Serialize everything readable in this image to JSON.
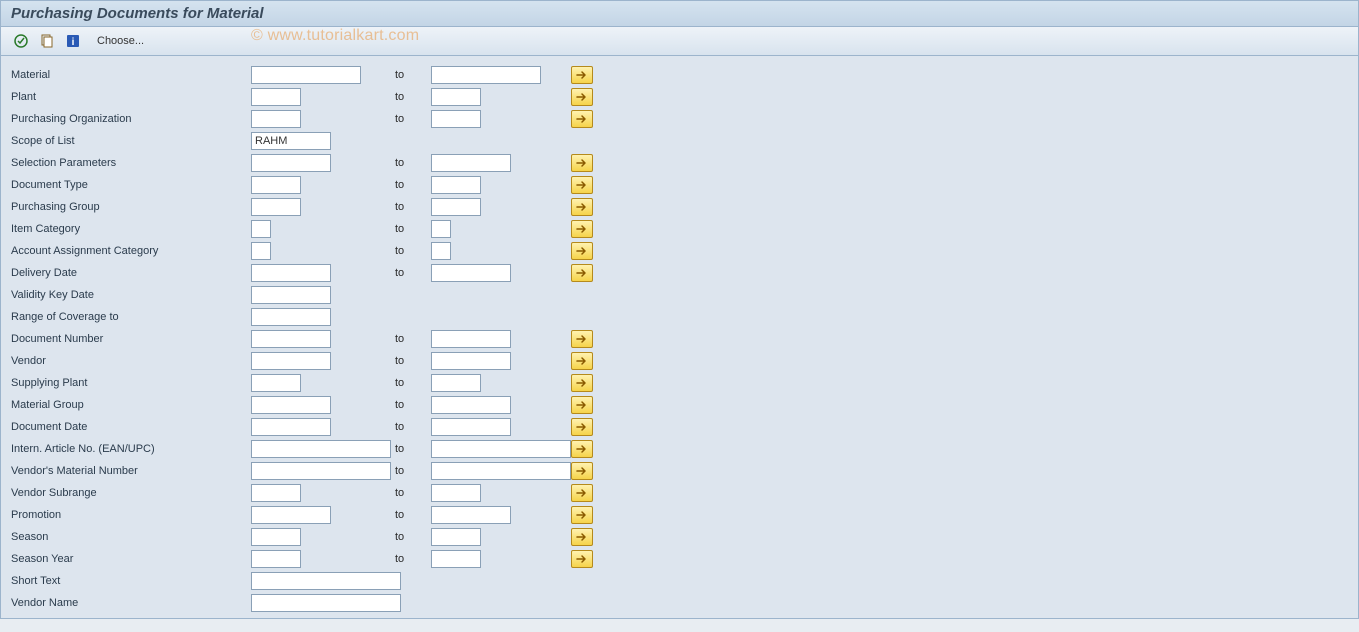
{
  "window_title": "Purchasing Documents for Material",
  "toolbar": {
    "choose_label": "Choose..."
  },
  "watermark": "© www.tutorialkart.com",
  "ui": {
    "to_label": "to"
  },
  "rows": {
    "material": {
      "label": "Material",
      "from": "",
      "to": "",
      "showTo": true,
      "btn": true,
      "fromW": "w110",
      "toW": "w110"
    },
    "plant": {
      "label": "Plant",
      "from": "",
      "to": "",
      "showTo": true,
      "btn": true,
      "fromW": "w50",
      "toW": "w50"
    },
    "purchOrg": {
      "label": "Purchasing Organization",
      "from": "",
      "to": "",
      "showTo": true,
      "btn": true,
      "fromW": "w50",
      "toW": "w50"
    },
    "scopeList": {
      "label": "Scope of List",
      "from": "RAHM",
      "to": "",
      "showTo": false,
      "btn": false,
      "fromW": "w80",
      "toW": ""
    },
    "selParams": {
      "label": "Selection Parameters",
      "from": "",
      "to": "",
      "showTo": true,
      "btn": true,
      "fromW": "w80",
      "toW": "w80"
    },
    "docType": {
      "label": "Document Type",
      "from": "",
      "to": "",
      "showTo": true,
      "btn": true,
      "fromW": "w50",
      "toW": "w50"
    },
    "purchGrp": {
      "label": "Purchasing Group",
      "from": "",
      "to": "",
      "showTo": true,
      "btn": true,
      "fromW": "w50",
      "toW": "w50"
    },
    "itemCat": {
      "label": "Item Category",
      "from": "",
      "to": "",
      "showTo": true,
      "btn": true,
      "fromW": "w20",
      "toW": "w20"
    },
    "acctAssign": {
      "label": "Account Assignment Category",
      "from": "",
      "to": "",
      "showTo": true,
      "btn": true,
      "fromW": "w20",
      "toW": "w20"
    },
    "deliveryDate": {
      "label": "Delivery Date",
      "from": "",
      "to": "",
      "showTo": true,
      "btn": true,
      "fromW": "w80",
      "toW": "w80"
    },
    "validityKey": {
      "label": "Validity Key Date",
      "from": "",
      "to": "",
      "showTo": false,
      "btn": false,
      "fromW": "w80",
      "toW": ""
    },
    "rangeCoverage": {
      "label": "Range of Coverage to",
      "from": "",
      "to": "",
      "showTo": false,
      "btn": false,
      "fromW": "w80",
      "toW": ""
    },
    "docNumber": {
      "label": "Document Number",
      "from": "",
      "to": "",
      "showTo": true,
      "btn": true,
      "fromW": "w80",
      "toW": "w80"
    },
    "vendor": {
      "label": "Vendor",
      "from": "",
      "to": "",
      "showTo": true,
      "btn": true,
      "fromW": "w80",
      "toW": "w80"
    },
    "supplyPlant": {
      "label": "Supplying Plant",
      "from": "",
      "to": "",
      "showTo": true,
      "btn": true,
      "fromW": "w50",
      "toW": "w50"
    },
    "matGroup": {
      "label": "Material Group",
      "from": "",
      "to": "",
      "showTo": true,
      "btn": true,
      "fromW": "w80",
      "toW": "w80"
    },
    "docDate": {
      "label": "Document Date",
      "from": "",
      "to": "",
      "showTo": true,
      "btn": true,
      "fromW": "w80",
      "toW": "w80"
    },
    "ean": {
      "label": "Intern. Article No. (EAN/UPC)",
      "from": "",
      "to": "",
      "showTo": true,
      "btn": true,
      "fromW": "w140",
      "toW": "w140"
    },
    "vendMatNo": {
      "label": "Vendor's Material Number",
      "from": "",
      "to": "",
      "showTo": true,
      "btn": true,
      "fromW": "w140",
      "toW": "w140"
    },
    "vendSub": {
      "label": "Vendor Subrange",
      "from": "",
      "to": "",
      "showTo": true,
      "btn": true,
      "fromW": "w50",
      "toW": "w50"
    },
    "promotion": {
      "label": "Promotion",
      "from": "",
      "to": "",
      "showTo": true,
      "btn": true,
      "fromW": "w80",
      "toW": "w80"
    },
    "season": {
      "label": "Season",
      "from": "",
      "to": "",
      "showTo": true,
      "btn": true,
      "fromW": "w50",
      "toW": "w50"
    },
    "seasonYear": {
      "label": "Season Year",
      "from": "",
      "to": "",
      "showTo": true,
      "btn": true,
      "fromW": "w50",
      "toW": "w50"
    },
    "shortText": {
      "label": "Short Text",
      "from": "",
      "to": "",
      "showTo": false,
      "btn": false,
      "fromW": "w285",
      "toW": ""
    },
    "vendorName": {
      "label": "Vendor Name",
      "from": "",
      "to": "",
      "showTo": false,
      "btn": false,
      "fromW": "w285",
      "toW": ""
    }
  },
  "row_order": [
    "material",
    "plant",
    "purchOrg",
    "scopeList",
    "selParams",
    "docType",
    "purchGrp",
    "itemCat",
    "acctAssign",
    "deliveryDate",
    "validityKey",
    "rangeCoverage",
    "docNumber",
    "vendor",
    "supplyPlant",
    "matGroup",
    "docDate",
    "ean",
    "vendMatNo",
    "vendSub",
    "promotion",
    "season",
    "seasonYear",
    "shortText",
    "vendorName"
  ]
}
